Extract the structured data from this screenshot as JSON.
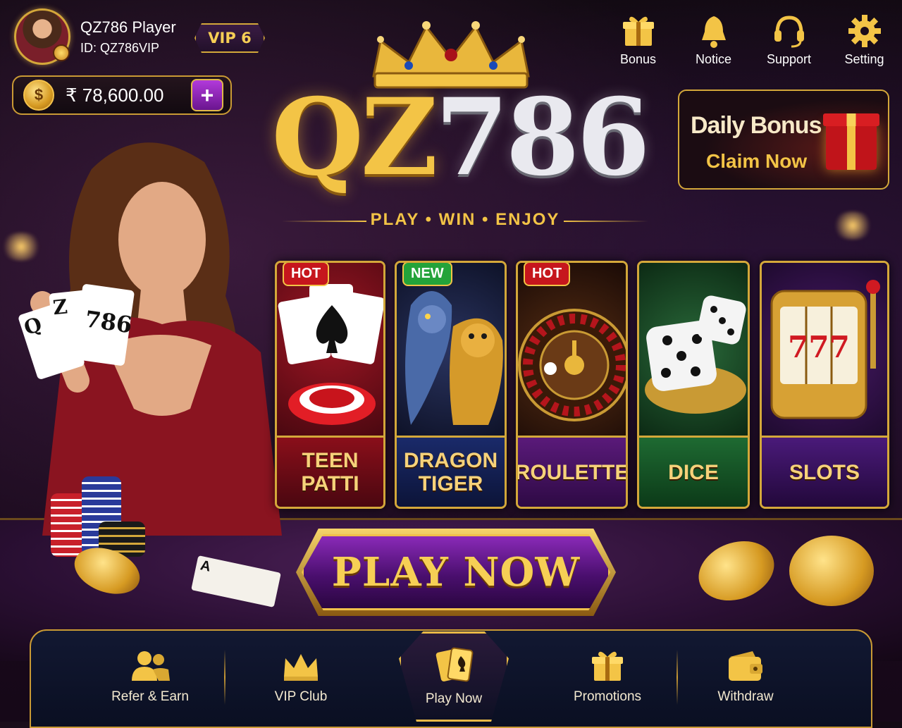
{
  "profile": {
    "name": "QZ786 Player",
    "id": "ID: QZ786VIP",
    "vip": "VIP 6",
    "balance": "₹ 78,600.00",
    "coin_symbol": "$",
    "add_symbol": "+"
  },
  "topnav": {
    "items": [
      {
        "label": "Bonus",
        "icon": "gift-icon"
      },
      {
        "label": "Notice",
        "icon": "bell-icon"
      },
      {
        "label": "Support",
        "icon": "headset-icon"
      },
      {
        "label": "Setting",
        "icon": "gear-icon"
      }
    ]
  },
  "logo": {
    "part1": "QZ",
    "part2": "786",
    "tagline": "PLAY • WIN • ENJOY"
  },
  "daily_bonus": {
    "title": "Daily Bonus",
    "cta": "Claim Now"
  },
  "games": [
    {
      "name_line1": "TEEN",
      "name_line2": "PATTI",
      "tag": "HOT"
    },
    {
      "name_line1": "DRAGON",
      "name_line2": "TIGER",
      "tag": "NEW"
    },
    {
      "name_line1": "ROULETTE",
      "name_line2": "",
      "tag": "HOT"
    },
    {
      "name_line1": "DICE",
      "name_line2": "",
      "tag": ""
    },
    {
      "name_line1": "SLOTS",
      "name_line2": "",
      "tag": ""
    }
  ],
  "play_now": "PLAY NOW",
  "card_art_text": {
    "hand_cards": [
      "Q",
      "Z",
      "786"
    ],
    "ace": "A",
    "slots": "777"
  },
  "bottomnav": {
    "items": [
      {
        "label": "Refer & Earn",
        "icon": "users-icon"
      },
      {
        "label": "VIP Club",
        "icon": "crown-icon"
      },
      {
        "label": "Play Now",
        "icon": "cards-icon"
      },
      {
        "label": "Promotions",
        "icon": "gift-icon"
      },
      {
        "label": "Withdraw",
        "icon": "wallet-icon"
      }
    ]
  },
  "colors": {
    "gold": "#f3c446",
    "purple": "#6a158f",
    "hot_red": "#c6161d",
    "new_green": "#23a33a",
    "nav_bg": "#0a0f22"
  }
}
